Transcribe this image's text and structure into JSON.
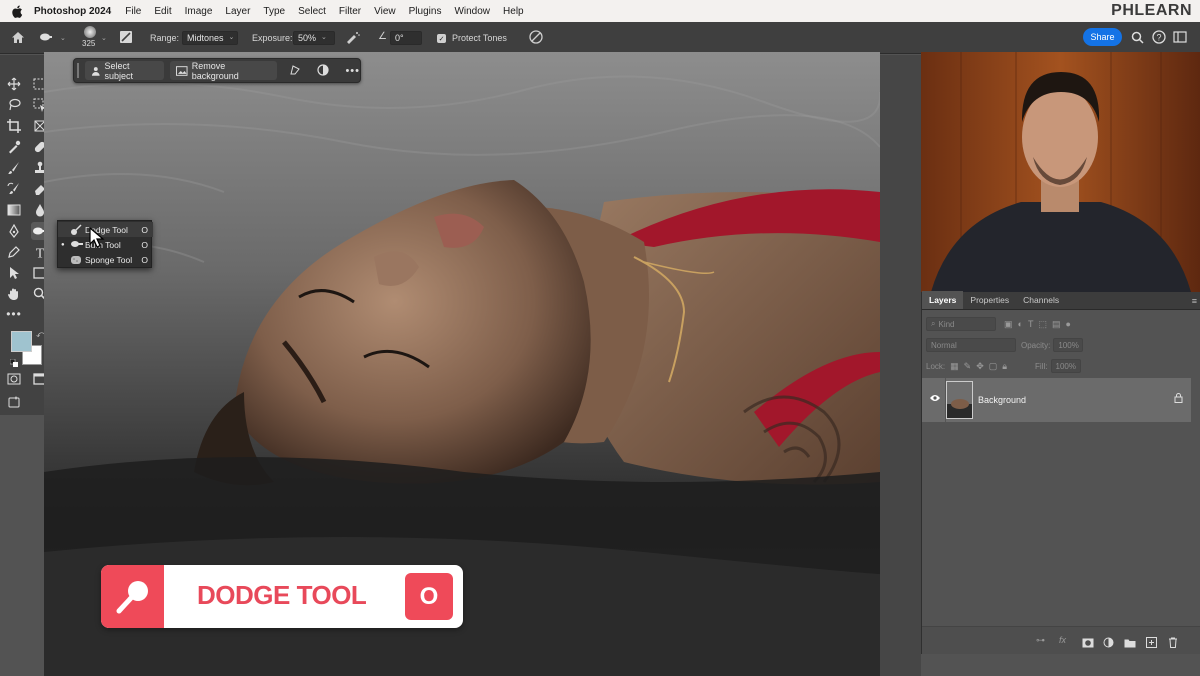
{
  "menubar": {
    "app_name": "Photoshop 2024",
    "items": [
      "File",
      "Edit",
      "Image",
      "Layer",
      "Type",
      "Select",
      "Filter",
      "View",
      "Plugins",
      "Window",
      "Help"
    ],
    "brand": "PHLEARN"
  },
  "options_bar": {
    "brush_size": "325",
    "range_label": "Range:",
    "range_value": "Midtones",
    "exposure_label": "Exposure:",
    "exposure_value": "50%",
    "angle_value": "0°",
    "protect_tones_label": "Protect Tones",
    "protect_tones_checked": true,
    "share_label": "Share"
  },
  "task_bar": {
    "select_subject": "Select subject",
    "remove_background": "Remove background"
  },
  "tool_flyout": {
    "items": [
      {
        "label": "Dodge Tool",
        "key": "O",
        "selected": true
      },
      {
        "label": "Burn Tool",
        "key": "O",
        "selected": false
      },
      {
        "label": "Sponge Tool",
        "key": "O",
        "selected": false
      }
    ]
  },
  "colors": {
    "foreground": "#9fc3cf",
    "background": "#ffffff",
    "accent": "#1473e6",
    "callout": "#ef4a59"
  },
  "layers_panel": {
    "tabs": [
      "Layers",
      "Properties",
      "Channels"
    ],
    "active_tab": "Layers",
    "filter_kind": "Kind",
    "blend_mode": "Normal",
    "opacity_label": "Opacity:",
    "opacity_value": "100%",
    "lock_label": "Lock:",
    "fill_label": "Fill:",
    "fill_value": "100%",
    "layers": [
      {
        "name": "Background",
        "visible": true,
        "locked": true
      }
    ]
  },
  "callout": {
    "title": "DODGE TOOL",
    "shortcut": "O"
  }
}
